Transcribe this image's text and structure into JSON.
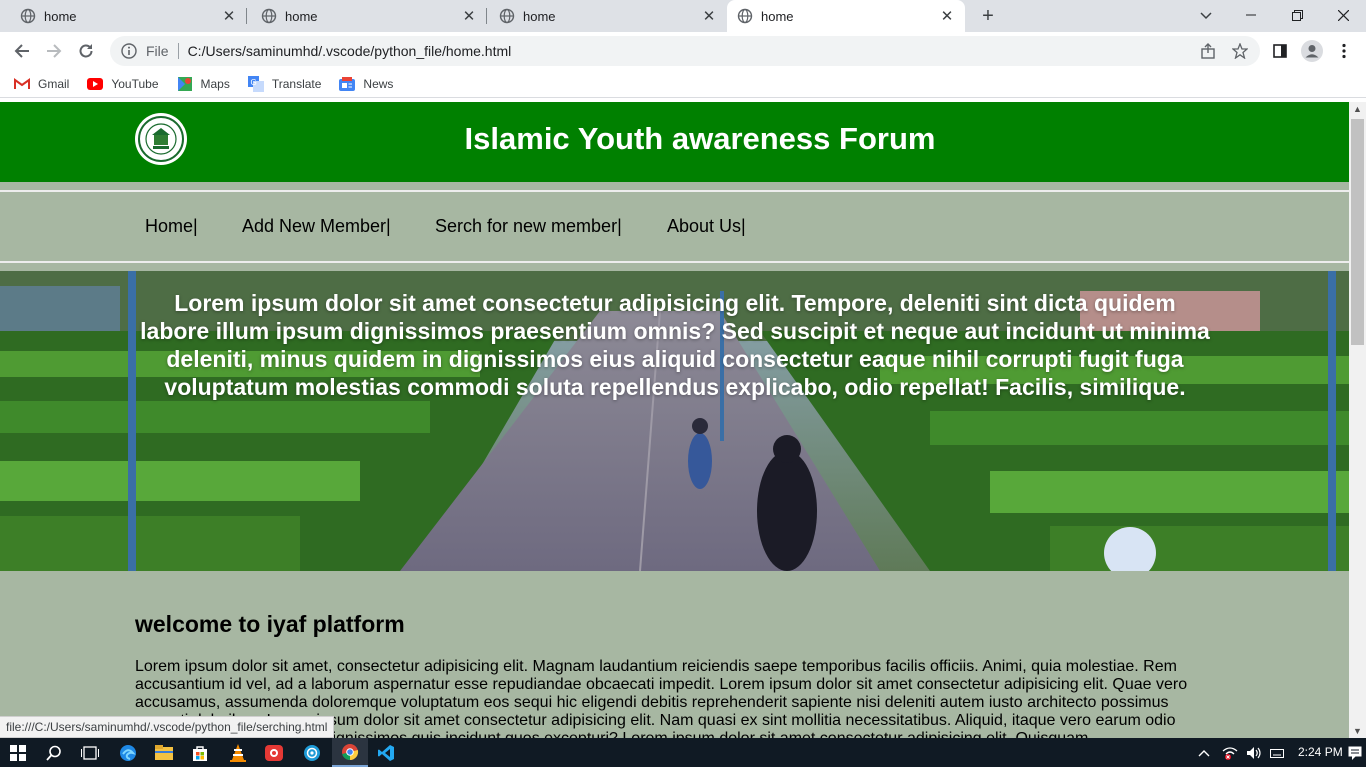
{
  "browser": {
    "tabs": [
      {
        "title": "home",
        "active": false
      },
      {
        "title": "home",
        "active": false
      },
      {
        "title": "home",
        "active": false
      },
      {
        "title": "home",
        "active": true
      }
    ],
    "address": {
      "scheme_label": "File",
      "url": "C:/Users/saminumhd/.vscode/python_file/home.html"
    },
    "bookmarks": [
      {
        "label": "Gmail",
        "icon": "gmail-icon"
      },
      {
        "label": "YouTube",
        "icon": "youtube-icon"
      },
      {
        "label": "Maps",
        "icon": "maps-icon"
      },
      {
        "label": "Translate",
        "icon": "translate-icon"
      },
      {
        "label": "News",
        "icon": "news-icon"
      }
    ],
    "status_url": "file:///C:/Users/saminumhd/.vscode/python_file/serching.html"
  },
  "site": {
    "title": "Islamic Youth awareness Forum",
    "nav": [
      "Home|",
      "Add New Member|",
      "Serch for new member|",
      "About Us|"
    ],
    "hero_text": "Lorem ipsum dolor sit amet consectetur adipisicing elit. Tempore, deleniti sint dicta quidem labore illum ipsum dignissimos praesentium omnis? Sed suscipit et neque aut incidunt ut minima deleniti, minus quidem in dignissimos eius aliquid consectetur eaque nihil corrupti fugit fuga voluptatum molestias commodi soluta repellendus explicabo, odio repellat! Facilis, similique.",
    "welcome_heading": "welcome to iyaf platform",
    "body_text": "Lorem ipsum dolor sit amet, consectetur adipisicing elit. Magnam laudantium reiciendis saepe temporibus facilis officiis. Animi, quia molestiae. Rem accusantium id vel, ad a laborum aspernatur esse repudiandae obcaecati impedit. Lorem ipsum dolor sit amet consectetur adipisicing elit. Quae vero accusamus, assumenda doloremque voluptatum eos sequi hic eligendi debitis reprehenderit sapiente nisi deleniti autem iusto architecto possimus corrupti doloribus. Lorem ipsum dolor sit amet consectetur adipisicing elit. Nam quasi ex sint mollitia necessitatibus. Aliquid, itaque vero earum odio cumque quae assumenda dignissimos quis incidunt quos excepturi? Lorem ipsum dolor sit amet consectetur adipisicing elit. Quisquam"
  },
  "taskbar": {
    "clock": "2:24 PM",
    "apps": [
      "start-button",
      "search-button",
      "task-view-button",
      "edge-app",
      "file-explorer-app",
      "store-app",
      "vlc-app",
      "camera-app",
      "photos-app",
      "chrome-app",
      "vscode-app"
    ],
    "active_app": "chrome-app"
  },
  "colors": {
    "header_green": "#008000",
    "page_bg": "#a7b7a2",
    "tabstrip_bg": "#dee1e6"
  }
}
